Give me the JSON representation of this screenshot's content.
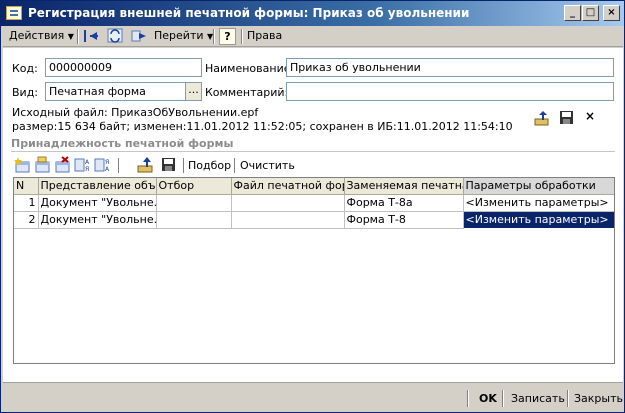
{
  "window": {
    "title": "Регистрация внешней печатной формы: Приказ об увольнении"
  },
  "menubar": {
    "actions_label": "Действия",
    "goto_label": "Перейти",
    "help_glyph": "?",
    "rights_label": "Права"
  },
  "form": {
    "code_label": "Код:",
    "code_value": "000000009",
    "kind_label": "Вид:",
    "kind_value": "Печатная форма",
    "kind_dots": "...",
    "name_label": "Наименование:",
    "name_value": "Приказ об увольнении",
    "comment_label": "Комментарий:",
    "comment_value": "",
    "source_line": "Исходный файл: ПриказОбУвольнении.epf",
    "size_line": "размер:15 634 байт; изменен:11.01.2012 11:52:05; сохранен в ИБ:11.01.2012 11:54:10"
  },
  "section": {
    "title": "Принадлежность печатной формы",
    "pick_label": "Подбор",
    "clear_label": "Очистить"
  },
  "table": {
    "columns": [
      "N",
      "Представление объ...",
      "Отбор",
      "Файл печатной фор...",
      "Заменяемая печатна...",
      "Параметры обработки"
    ],
    "rows": [
      {
        "n": "1",
        "object": "Документ \"Увольне...",
        "filter": "",
        "file": "",
        "replaced": "Форма Т-8а",
        "params": "<Изменить параметры>"
      },
      {
        "n": "2",
        "object": "Документ \"Увольне...",
        "filter": "",
        "file": "",
        "replaced": "Форма Т-8",
        "params": "<Изменить параметры>"
      }
    ]
  },
  "footer": {
    "ok_label": "OK",
    "save_label": "Записать",
    "close_label": "Закрыть"
  },
  "colors": {
    "title_start": "#0a246a",
    "title_end": "#a6caf0",
    "selection": "#0a246a",
    "chrome": "#d4d0c8"
  }
}
